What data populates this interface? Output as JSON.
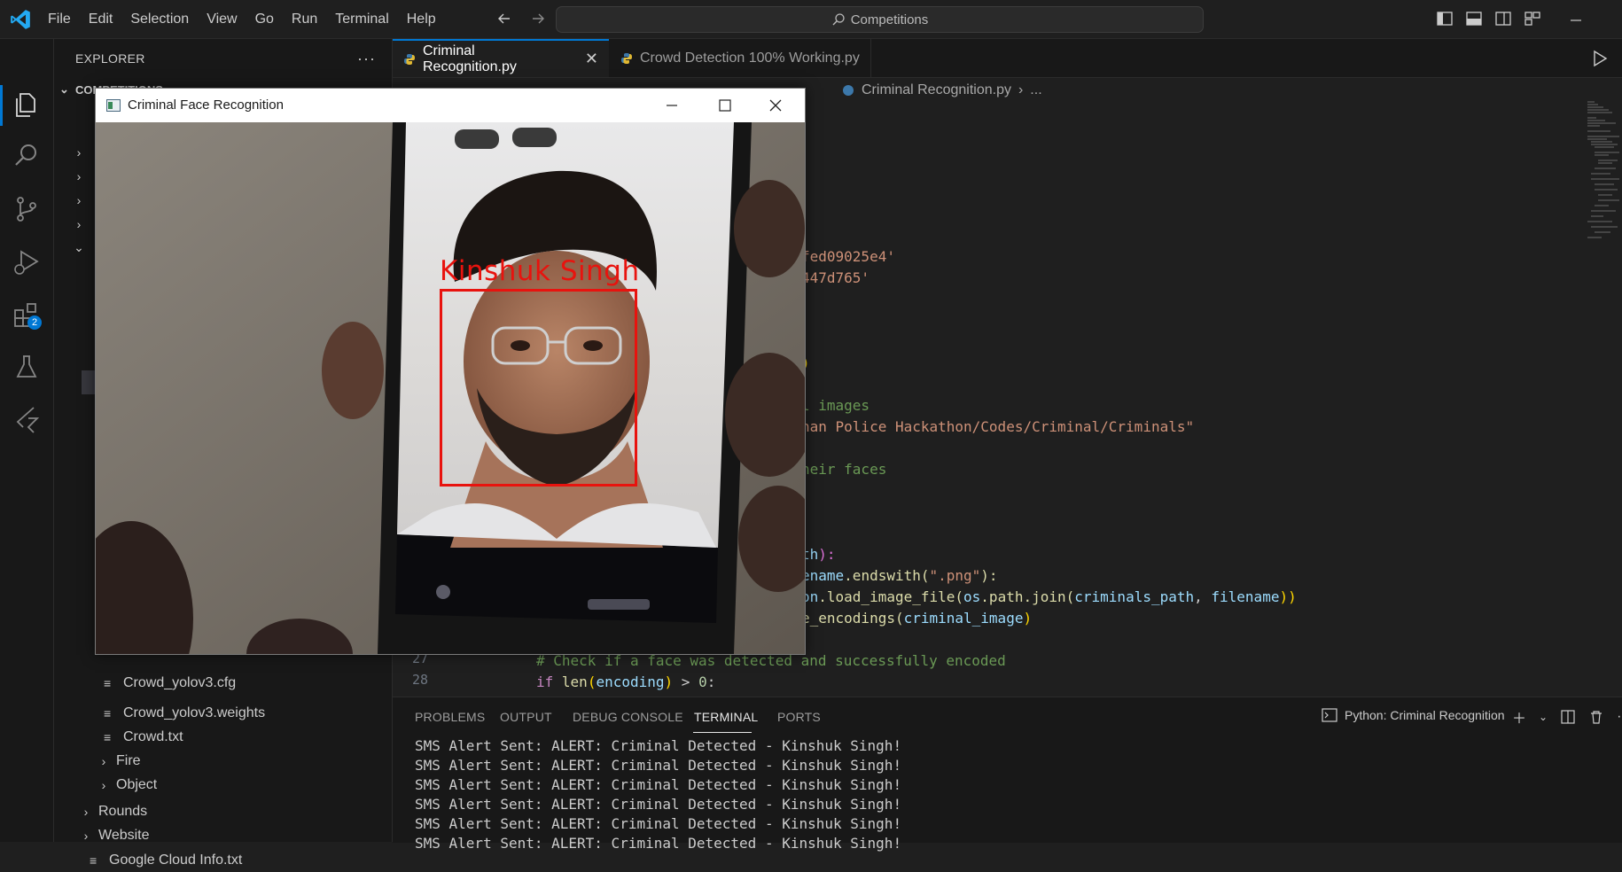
{
  "titlebar": {
    "menu": [
      "File",
      "Edit",
      "Selection",
      "View",
      "Go",
      "Run",
      "Terminal",
      "Help"
    ],
    "search_text": "Competitions"
  },
  "activitybar": {
    "extensions_badge": "2"
  },
  "sidebar": {
    "title": "EXPLORER",
    "more": "···",
    "workspace": "COMPETITIONS",
    "tree": [
      {
        "label": "Crowd_yolov3.cfg",
        "type": "file"
      },
      {
        "label": "Crowd_yolov3.weights",
        "type": "file"
      },
      {
        "label": "Crowd.txt",
        "type": "file"
      },
      {
        "label": "Fire",
        "type": "folder"
      },
      {
        "label": "Object",
        "type": "folder"
      },
      {
        "label": "Rounds",
        "type": "folder"
      },
      {
        "label": "Website",
        "type": "folder"
      },
      {
        "label": "Google Cloud Info.txt",
        "type": "file"
      }
    ]
  },
  "editor": {
    "tabs": [
      {
        "label": "Criminal Recognition.py",
        "active": true
      },
      {
        "label": "Crowd Detection 100% Working.py",
        "active": false
      }
    ],
    "breadcrumb": {
      "file": "Criminal Recognition.py",
      "more": "..."
    },
    "visible_code": {
      "l1": "fed09025e4'",
      "l2": "447d765'",
      "l3": ")",
      "l4": "l images",
      "l5": "han Police Hackathon/Codes/Criminal/Criminals\"",
      "l6": "heir faces",
      "l7a": "th",
      "l7b": "):",
      "l8a": "ename",
      "l8b": ".endswith(",
      "l8c": "\".png\"",
      "l8d": "):",
      "l9a": "on",
      "l9b": ".load_image_file(",
      "l9c": "os",
      "l9d": ".path.join(",
      "l9e": "criminals_path",
      "l9f": ", ",
      "l9g": "filename",
      "l9h": "))",
      "l10a": "e_encodings(",
      "l10b": "criminal_image",
      "l10c": ")",
      "line27_num": "27",
      "line27": "# Check if a face was detected and successfully encoded",
      "line28_num": "28",
      "line28_kw": "if",
      "line28_fn": "len",
      "line28_var": "encoding",
      "line28_rest": "> ",
      "line28_num_val": "0",
      "line28_end": ":"
    }
  },
  "panel": {
    "tabs": [
      "PROBLEMS",
      "OUTPUT",
      "DEBUG CONSOLE",
      "TERMINAL",
      "PORTS"
    ],
    "active_tab": "TERMINAL",
    "terminal_name": "Python: Criminal Recognition",
    "terminal_lines": [
      "SMS Alert Sent: ALERT: Criminal Detected - Kinshuk Singh!",
      "SMS Alert Sent: ALERT: Criminal Detected - Kinshuk Singh!",
      "SMS Alert Sent: ALERT: Criminal Detected - Kinshuk Singh!",
      "SMS Alert Sent: ALERT: Criminal Detected - Kinshuk Singh!",
      "SMS Alert Sent: ALERT: Criminal Detected - Kinshuk Singh!",
      "SMS Alert Sent: ALERT: Criminal Detected - Kinshuk Singh!"
    ]
  },
  "cv_window": {
    "title": "Criminal Face Recognition",
    "detected_name": "Kinshuk Singh",
    "box_color": "#e8130e"
  },
  "colors": {
    "accent": "#0078d4",
    "background": "#1f1f1f",
    "sidebar": "#181818"
  }
}
